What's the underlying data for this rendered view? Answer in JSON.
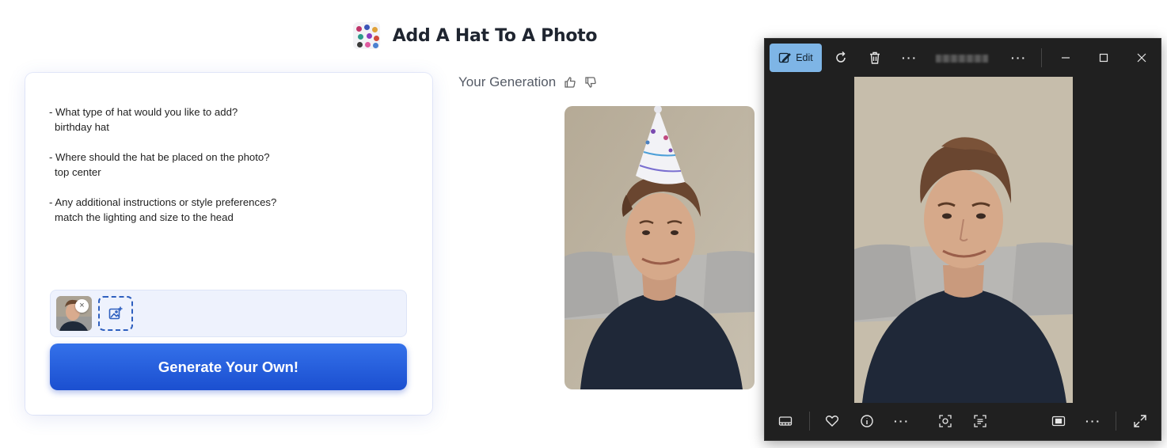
{
  "header": {
    "title": "Add A Hat To A Photo",
    "logo_icon": "hat-collage-logo"
  },
  "prompt": {
    "items": [
      {
        "question": "- What type of hat would you like to add?",
        "answer": "birthday hat"
      },
      {
        "question": "- Where should the hat be placed on the photo?",
        "answer": "top center"
      },
      {
        "question": "- Any additional instructions or style preferences?",
        "answer": "match the lighting and size to the head"
      }
    ]
  },
  "upload": {
    "remove_label": "×",
    "add_icon": "add-image-icon"
  },
  "generate_button": {
    "label": "Generate Your Own!",
    "color_top": "#3471ea",
    "color_bottom": "#1b4fd0"
  },
  "generation": {
    "title": "Your Generation",
    "like_icon": "thumbs-up-icon",
    "dislike_icon": "thumbs-down-icon"
  },
  "viewer": {
    "edit_label": "Edit",
    "accent": "#7eb5e6",
    "top_icons": [
      "rotate-icon",
      "delete-icon",
      "more-icon",
      "more-icon",
      "minimize-icon",
      "maximize-icon",
      "close-icon"
    ],
    "bottom_icons": [
      "filmstrip-icon",
      "favorite-icon",
      "info-icon",
      "more-icon",
      "visual-search-icon",
      "text-scan-icon",
      "fit-icon",
      "more-icon",
      "fullscreen-icon"
    ]
  }
}
